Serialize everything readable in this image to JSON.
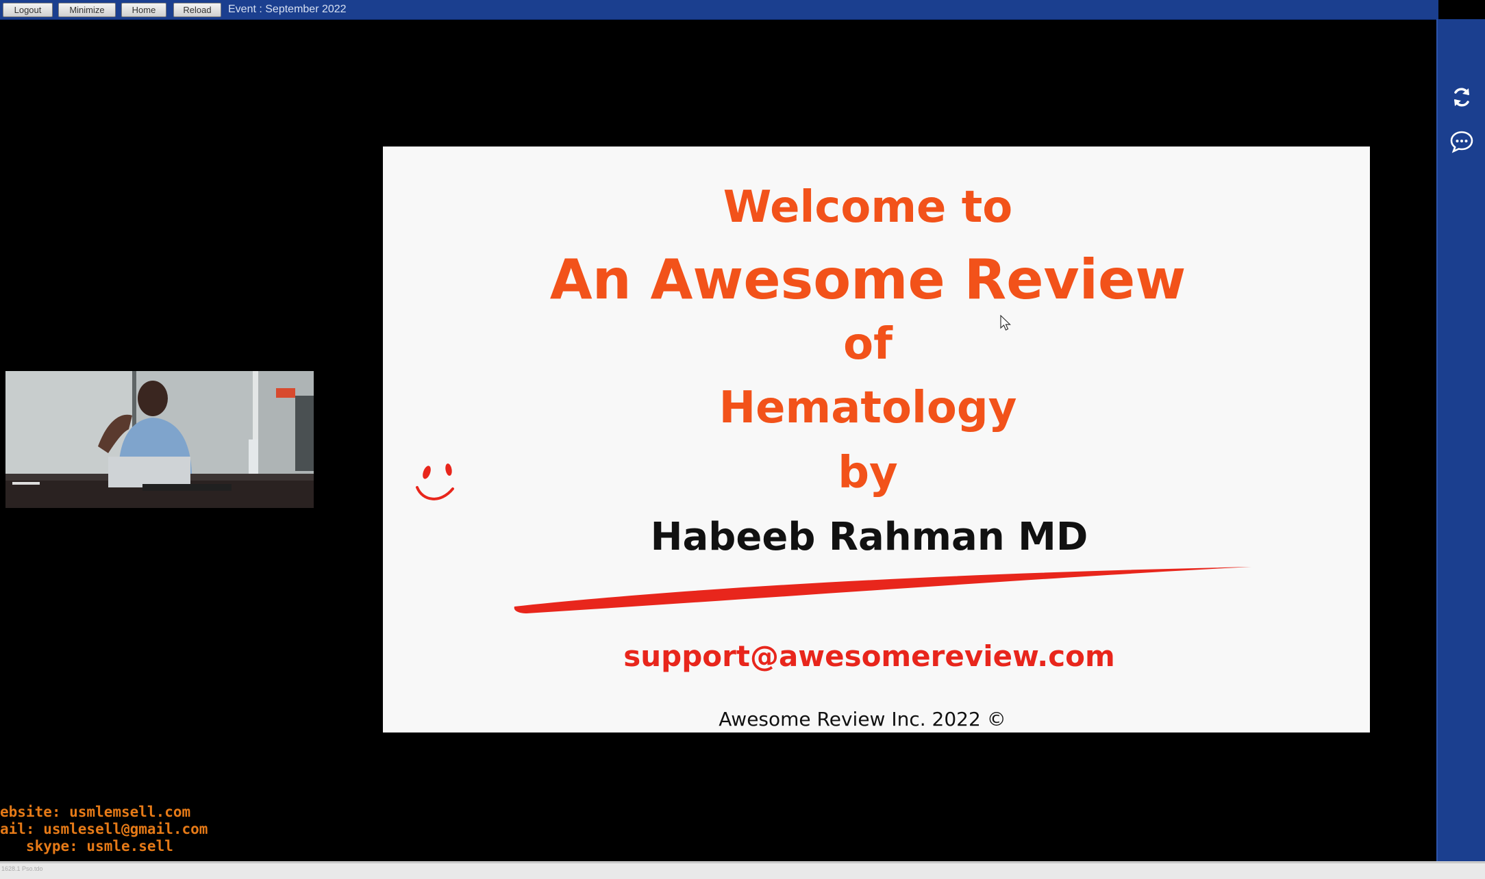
{
  "toolbar": {
    "logout_label": "Logout",
    "minimize_label": "Minimize",
    "home_label": "Home",
    "reload_label": "Reload",
    "event_label": "Event : September 2022",
    "bar_color": "#1b3f8f"
  },
  "side_panel": {
    "icons": [
      "refresh-icon",
      "chat-icon"
    ],
    "color": "#1b3f8f"
  },
  "slide": {
    "line1": "Welcome to",
    "line2": "An Awesome Review",
    "line3": "of",
    "line4": "Hematology",
    "line5": "by",
    "author": "Habeeb Rahman MD",
    "email": "support@awesomereview.com",
    "copyright": "Awesome Review Inc. 2022 ©",
    "accent_color": "#f2521a",
    "email_color": "#e8261c"
  },
  "contact": {
    "website": "ebsite: usmlemsell.com",
    "email": "ail: usmlesell@gmail.com",
    "skype": "   skype: usmle.sell",
    "color": "#e67a17"
  },
  "statusbar": {
    "text": "1628.1 Pso.tdo"
  }
}
